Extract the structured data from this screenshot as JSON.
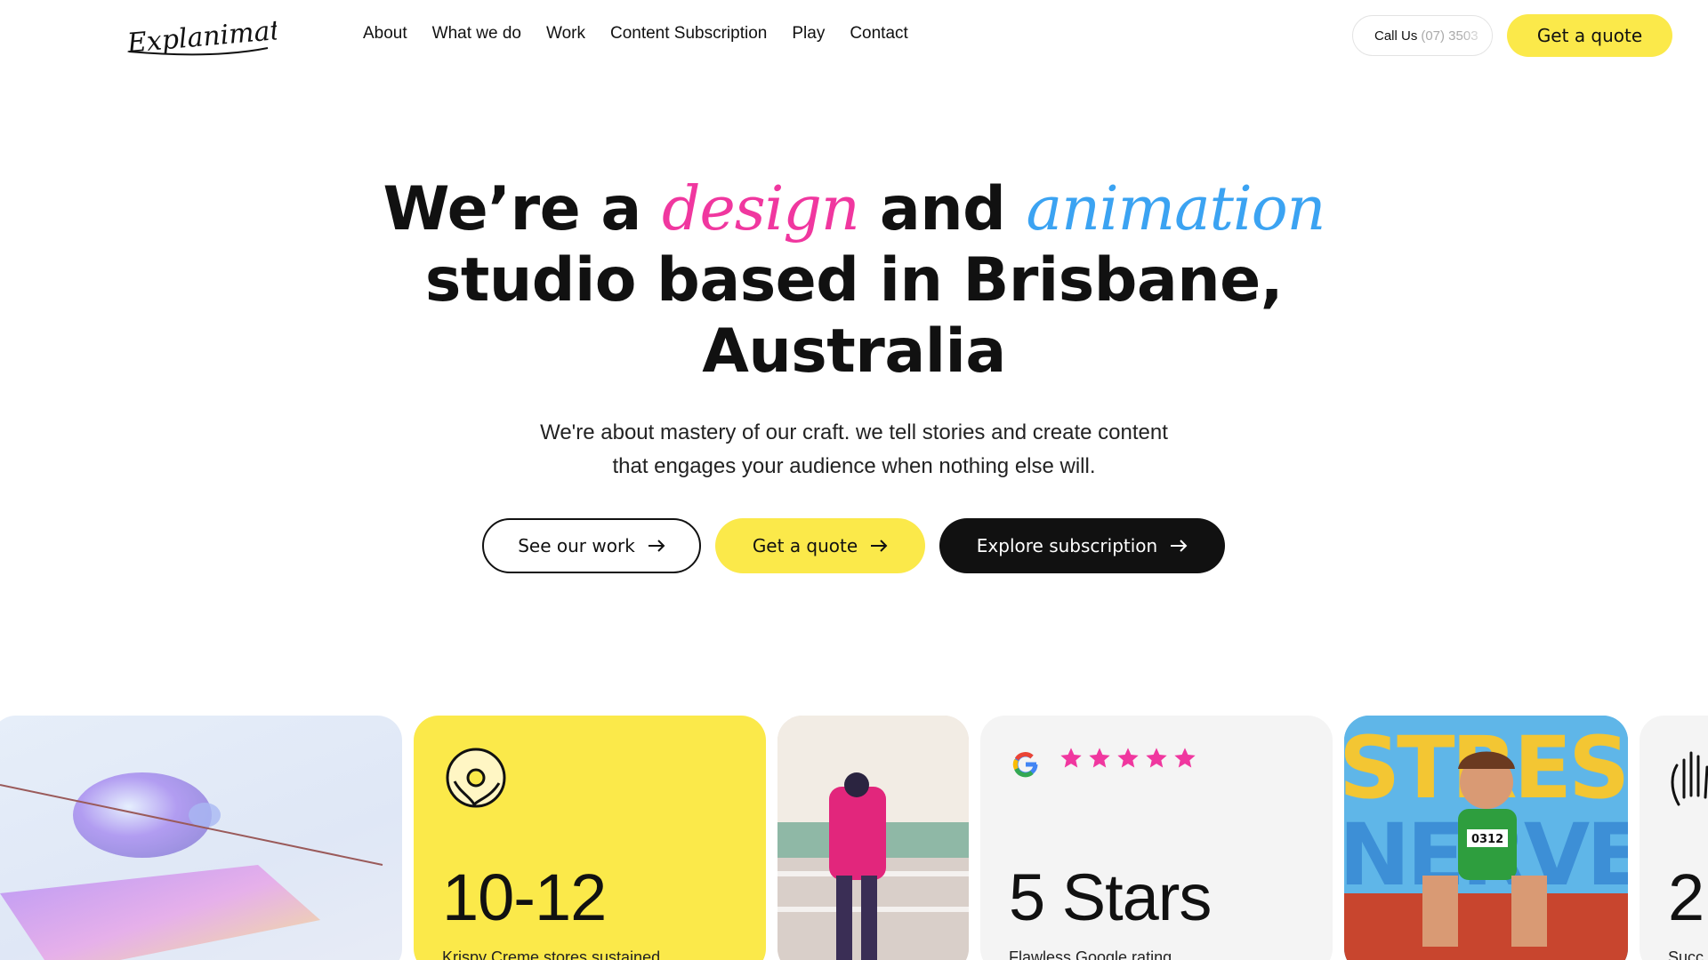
{
  "brand": {
    "logo_text": "Explanimate!"
  },
  "nav": {
    "items": [
      {
        "label": "About"
      },
      {
        "label": "What we do"
      },
      {
        "label": "Work"
      },
      {
        "label": "Content Subscription"
      },
      {
        "label": "Play"
      },
      {
        "label": "Contact"
      }
    ]
  },
  "header": {
    "call_label": "Call Us",
    "call_number": "(07) 3503",
    "quote_label": "Get a quote"
  },
  "hero": {
    "title_part1": "We’re a ",
    "title_word1": "design",
    "title_part2": " and ",
    "title_word2": "animation",
    "title_line2": "studio based in Brisbane,",
    "title_line3": "Australia",
    "subtitle_line1": "We're about mastery of our craft. we tell stories and create content",
    "subtitle_line2": "that engages your audience when nothing else will.",
    "buttons": {
      "see_work": "See our work",
      "get_quote": "Get a quote",
      "explore": "Explore subscription"
    }
  },
  "cards": {
    "krispy": {
      "number": "10-12",
      "caption": "Krispy Creme stores sustained"
    },
    "google": {
      "number": "5 Stars",
      "caption": "Flawless Google rating",
      "stars": 5
    },
    "athlete": {
      "text": "STRESS NERVES",
      "bib": "0312"
    },
    "partial": {
      "number": "2",
      "caption": "Succ"
    }
  },
  "colors": {
    "accent_yellow": "#fbe94a",
    "pink": "#f0379f",
    "blue": "#3ba3f2",
    "dark": "#111111"
  }
}
